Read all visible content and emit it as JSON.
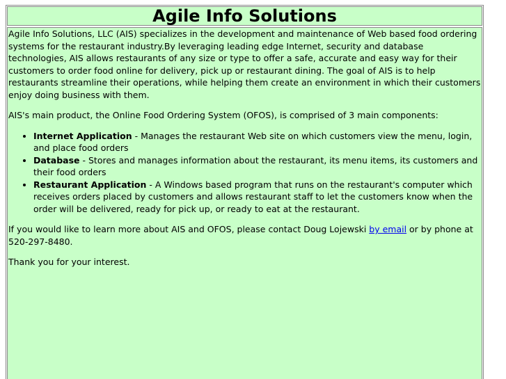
{
  "page": {
    "title": "Agile Info Solutions"
  },
  "content": {
    "intro": "Agile Info Solutions, LLC (AIS) specializes in the development and maintenance of Web based food ordering systems for the restaurant industry.By leveraging leading edge Internet, security and database technologies, AIS allows restaurants of any size or type to offer a safe, accurate and easy way for their customers to order food online for delivery, pick up or restaurant dining. The goal of AIS is to help restaurants streamline their operations, while helping them create an environment in which their customers enjoy doing business with them.",
    "product_intro": "AIS's main product, the Online Food Ordering System (OFOS), is comprised of 3 main components:",
    "components": [
      {
        "name": "Internet Application",
        "description": " - Manages the restaurant Web site on which customers view the menu, login, and place food orders"
      },
      {
        "name": "Database",
        "description": " - Stores and manages information about the restaurant, its menu items, its customers and their food orders"
      },
      {
        "name": "Restaurant Application",
        "description": " - A Windows based program that runs on the restaurant's computer which receives orders placed by customers and allows restaurant staff to let the customers know when the order will be delivered, ready for pick up, or ready to eat at the restaurant."
      }
    ],
    "contact_before": "If you would like to learn more about AIS and OFOS, please contact Doug Lojewski ",
    "contact_link": "by email",
    "contact_after": " or by phone at 520-297-8480.",
    "thanks": "Thank you for your interest."
  },
  "colors": {
    "background": "#c8ffc8",
    "link": "#0000ee",
    "border": "#888888"
  }
}
